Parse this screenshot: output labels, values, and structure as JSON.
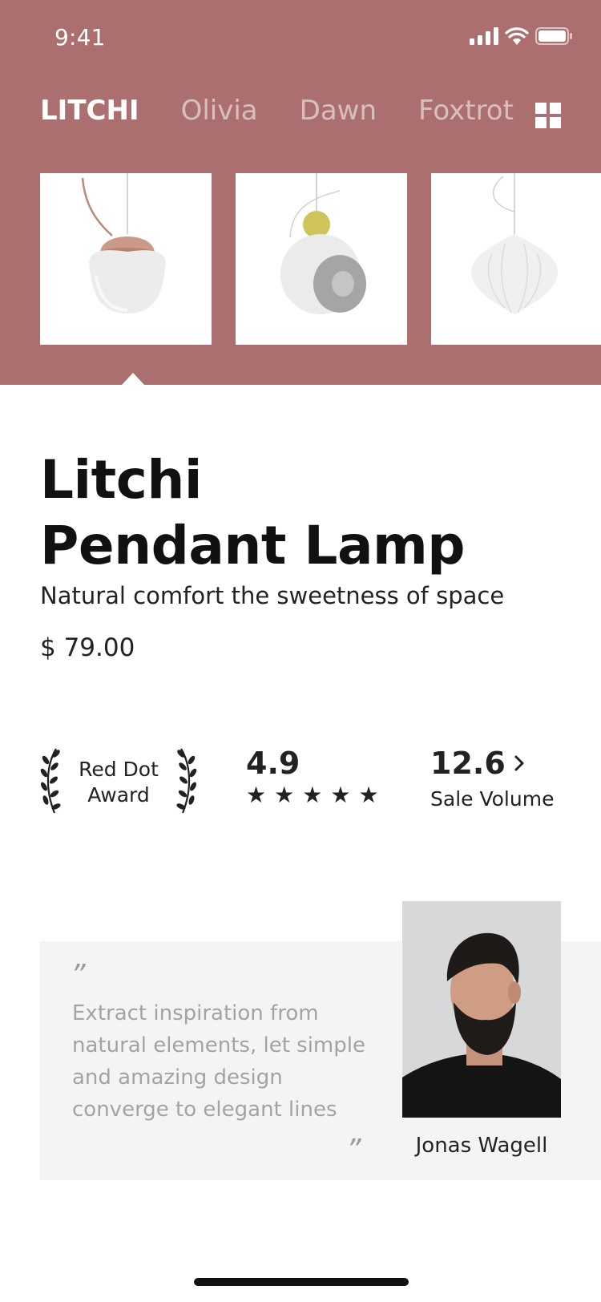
{
  "status_bar": {
    "time": "9:41"
  },
  "tabs": [
    {
      "label": "LITCHI",
      "active": true
    },
    {
      "label": "Olivia",
      "active": false
    },
    {
      "label": "Dawn",
      "active": false
    },
    {
      "label": "Foxtrot",
      "active": false
    }
  ],
  "icons": {
    "grid": "grid-view-icon",
    "signal": "cellular-signal-icon",
    "wifi": "wifi-icon",
    "battery": "battery-icon",
    "chevron": "chevron-right-icon",
    "laurel": "laurel-wreath-icon",
    "star": "star-icon"
  },
  "carousel": [
    {
      "name": "Litchi"
    },
    {
      "name": "Olivia"
    },
    {
      "name": "Dawn"
    }
  ],
  "product": {
    "title_line1": "Litchi",
    "title_line2": "Pendant Lamp",
    "tagline": "Natural comfort the sweetness of space",
    "price": "$ 79.00"
  },
  "stats": {
    "award_line1": "Red Dot",
    "award_line2": "Award",
    "rating": "4.9",
    "stars": 5,
    "sales_value": "12.6",
    "sales_label": "Sale Volume"
  },
  "quote": {
    "open_mark": "”",
    "text": "Extract inspiration from natural elements, let simple and amazing design converge to elegant lines",
    "close_mark": "”",
    "author": "Jonas Wagell"
  },
  "colors": {
    "header_bg": "#ac6f6f",
    "quote_bg": "#f4f4f4",
    "text_dark": "#111111",
    "text_muted": "#a3a3a3"
  }
}
